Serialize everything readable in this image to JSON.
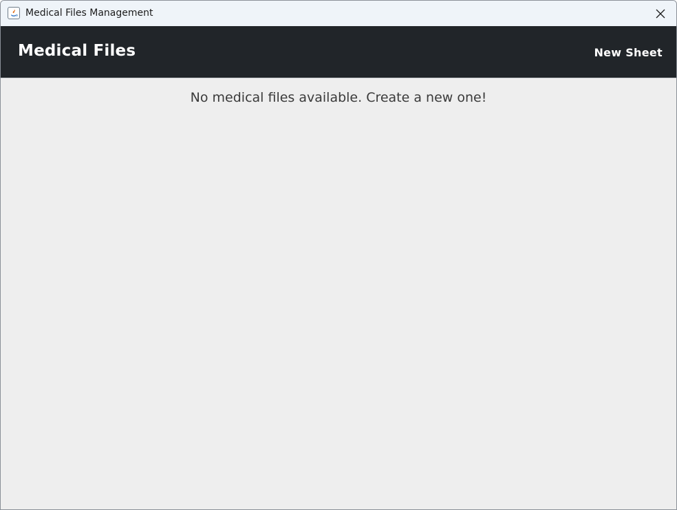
{
  "window": {
    "title": "Medical Files Management",
    "app_icon": "java-app-icon",
    "close_icon": "close-icon"
  },
  "header": {
    "title": "Medical Files",
    "new_sheet_label": "New Sheet",
    "background_color": "#212529"
  },
  "content": {
    "empty_message": "No medical files available. Create a new one!",
    "background_color": "#eeeeee"
  }
}
